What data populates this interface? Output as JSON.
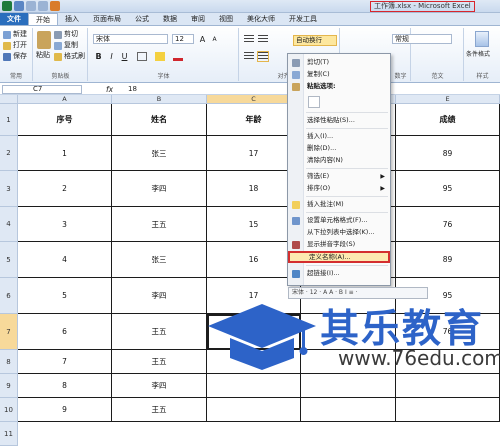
{
  "window": {
    "title": "工作簿.xlsx - Microsoft Excel"
  },
  "tabs": [
    {
      "label": "文件"
    },
    {
      "label": "开始"
    },
    {
      "label": "插入"
    },
    {
      "label": "页面布局"
    },
    {
      "label": "公式"
    },
    {
      "label": "数据"
    },
    {
      "label": "审阅"
    },
    {
      "label": "视图"
    },
    {
      "label": "美化大师"
    },
    {
      "label": "开发工具"
    }
  ],
  "ribbon": {
    "common": {
      "new": "新建",
      "open": "打开",
      "save": "保存",
      "group": "常用"
    },
    "clipboard": {
      "paste": "粘贴",
      "cut": "剪切",
      "copy": "复制",
      "format_painter": "格式刷",
      "group": "剪贴板"
    },
    "font": {
      "name": "宋体",
      "size": "12",
      "bold": "B",
      "italic": "I",
      "underline": "U",
      "grow": "A",
      "shrink": "A",
      "group": "字体"
    },
    "alignment": {
      "wrap": "自动换行",
      "group": "对齐方式"
    },
    "number": {
      "format": "常规",
      "group": "数字"
    },
    "styles": {
      "cond_format": "条件格式",
      "group": "样式"
    },
    "edit": {
      "group": "范文"
    }
  },
  "formula_bar": {
    "name_box": "C7",
    "fx": "fx",
    "value": "18"
  },
  "grid": {
    "columns": [
      "A",
      "B",
      "C",
      "D",
      "E"
    ],
    "rows": [
      "1",
      "2",
      "3",
      "4",
      "5",
      "6",
      "7",
      "8",
      "9",
      "10",
      "11"
    ],
    "headers": [
      "序号",
      "姓名",
      "年龄",
      "",
      "成绩"
    ],
    "data": [
      [
        "1",
        "张三",
        "17",
        "",
        "89"
      ],
      [
        "2",
        "李四",
        "18",
        "",
        "95"
      ],
      [
        "3",
        "王五",
        "15",
        "",
        "76"
      ],
      [
        "4",
        "张三",
        "16",
        "",
        "89"
      ],
      [
        "5",
        "李四",
        "17",
        "",
        "95"
      ],
      [
        "6",
        "王五",
        "18",
        "",
        "76"
      ],
      [
        "7",
        "王五",
        "",
        "",
        ""
      ],
      [
        "8",
        "李四",
        "",
        "",
        ""
      ],
      [
        "9",
        "王五",
        "",
        "",
        ""
      ]
    ]
  },
  "context_menu": {
    "cut": "剪切(T)",
    "copy": "复制(C)",
    "paste_options": "粘贴选项:",
    "paste_special": "选择性粘贴(S)...",
    "insert": "插入(I)...",
    "delete": "删除(D)...",
    "clear": "清除内容(N)",
    "filter": "筛选(E)",
    "sort": "排序(O)",
    "comment": "插入批注(M)",
    "format_cells": "设置单元格格式(F)...",
    "pick_list": "从下拉列表中选择(K)...",
    "phonetic": "显示拼音字段(S)",
    "define_name": "定义名称(A)...",
    "hyperlink": "超链接(I)..."
  },
  "mini_toolbar": {
    "text": "宋体 · 12 · A A · B I ≡ ·"
  },
  "watermark": {
    "cn": "其乐教育",
    "url": "www.76edu.com"
  },
  "colors": {
    "accent": "#2a6ebd",
    "highlight_border": "#d42e2e",
    "selected_header": "#f7d99a",
    "brand_blue": "#2d63c8"
  }
}
